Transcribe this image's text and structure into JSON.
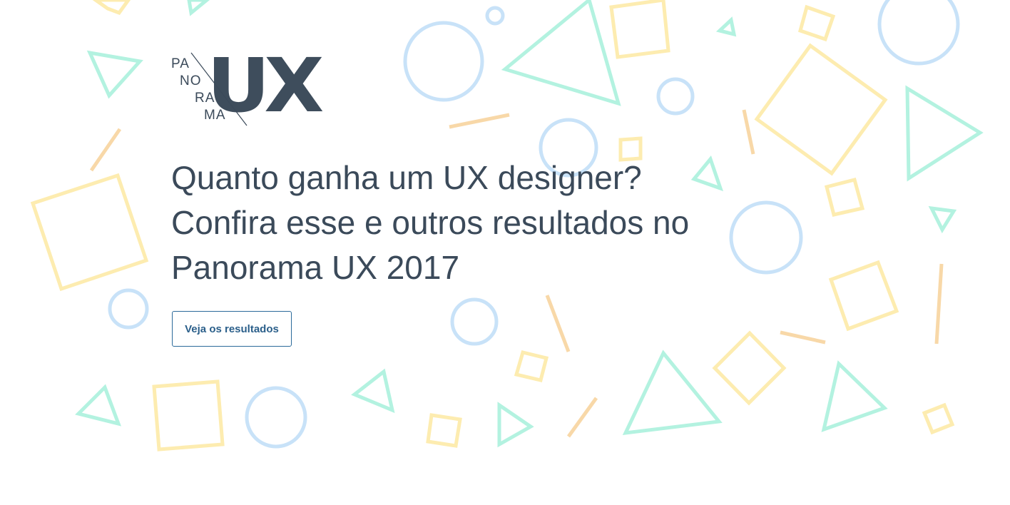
{
  "logo": {
    "line1": "PA",
    "line2": "NO",
    "line3": "RA",
    "line4": "MA",
    "mark": "UX"
  },
  "hero": {
    "headline_line1": "Quanto ganha um UX designer?",
    "headline_line2": "Confira esse e outros resultados no",
    "headline_line3": "Panorama UX 2017",
    "cta_label": "Veja os resultados"
  },
  "colors": {
    "text": "#3b4a5a",
    "button_border": "#2b6a9a",
    "shape_blue": "#c8e2f8",
    "shape_green": "#b3f2e0",
    "shape_yellow": "#fdecb0",
    "shape_orange": "#f8d8a8"
  }
}
